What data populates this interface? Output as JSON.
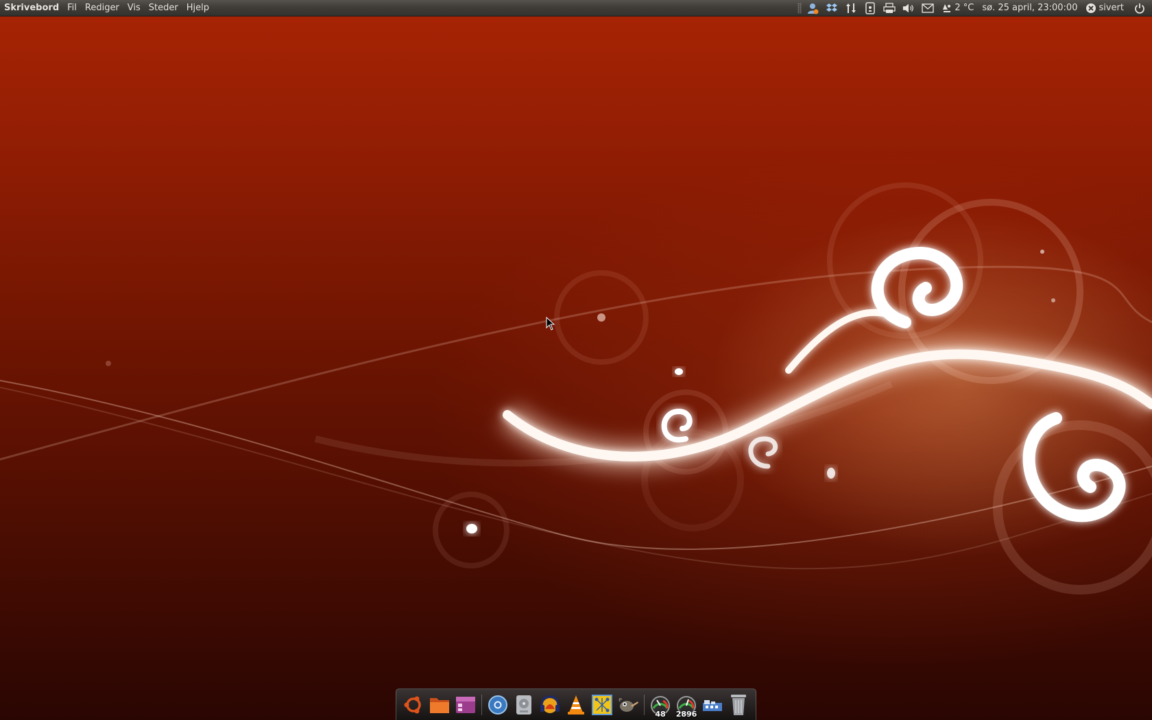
{
  "top_panel": {
    "menus": [
      "Skrivebord",
      "Fil",
      "Rediger",
      "Vis",
      "Steder",
      "Hjelp"
    ],
    "weather": "2 °C",
    "clock": "sø. 25 april, 23:00:00",
    "user": "sivert",
    "tray_icons": [
      "me-menu-icon",
      "dropbox-icon",
      "network-icon",
      "usb-drive-icon",
      "printer-icon",
      "volume-icon",
      "mail-icon",
      "weather-icon",
      "user-status-icon",
      "power-icon"
    ]
  },
  "dock": {
    "items": [
      "ubuntu-menu",
      "files",
      "pictures",
      "chromium",
      "disk-utility",
      "audio-player",
      "vlc",
      "network-tool",
      "gimp",
      "cpu-gauge",
      "memory-gauge",
      "system-monitor",
      "trash"
    ],
    "cpu_gauge_value": "48",
    "memory_gauge_value": "2896"
  },
  "colors": {
    "wallpaper_top": "#a92405",
    "wallpaper_bottom": "#2a0602",
    "panel": "#403d39",
    "panel_text": "#e6e3de"
  }
}
